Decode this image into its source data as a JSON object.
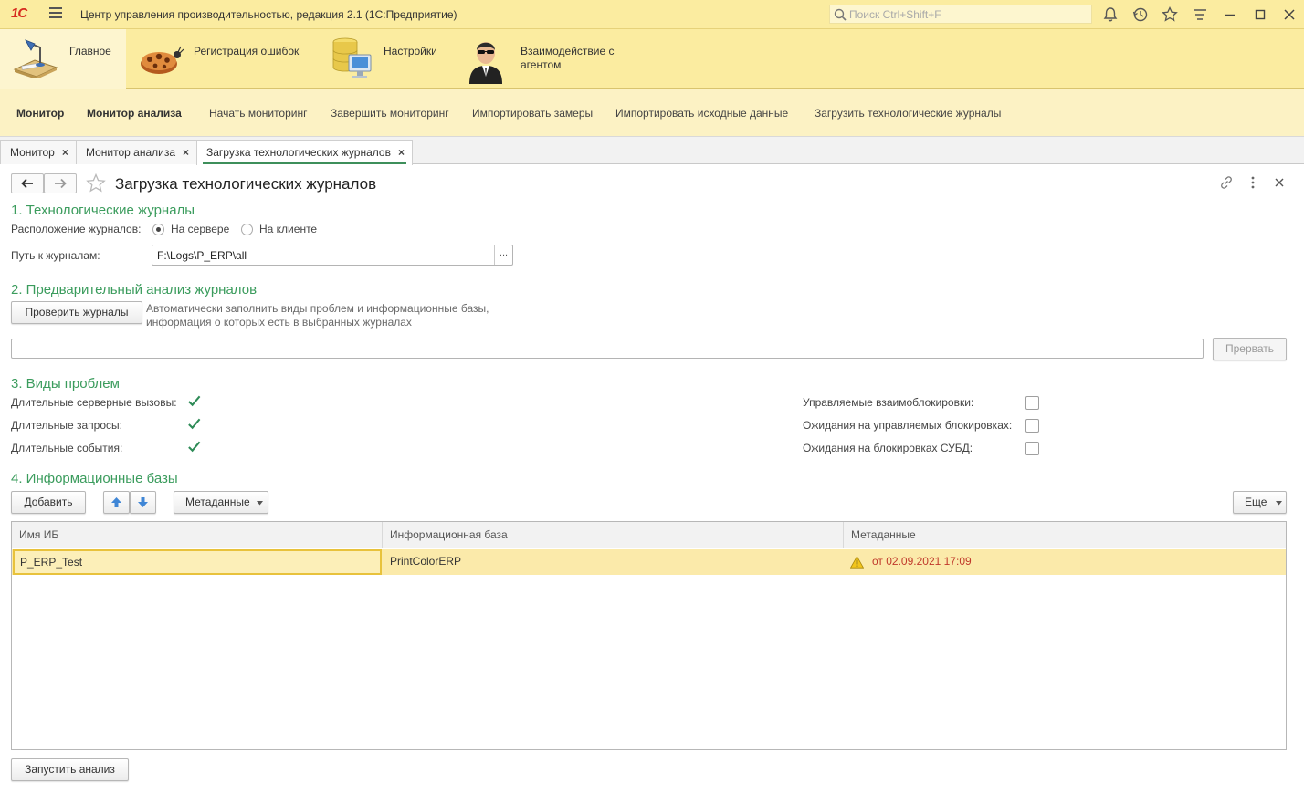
{
  "app": {
    "logo": "1С",
    "title": "Центр управления производительностью, редакция 2.1  (1С:Предприятие)",
    "search_placeholder": "Поиск Ctrl+Shift+F"
  },
  "sections": [
    {
      "label": "Главное"
    },
    {
      "label": "Регистрация ошибок"
    },
    {
      "label": "Настройки"
    },
    {
      "label": "Взаимодействие с агентом"
    }
  ],
  "actions": [
    {
      "label": "Монитор"
    },
    {
      "label": "Монитор анализа"
    },
    {
      "label": "Начать мониторинг"
    },
    {
      "label": "Завершить мониторинг"
    },
    {
      "label": "Импортировать замеры"
    },
    {
      "label": "Импортировать исходные данные"
    },
    {
      "label": "Загрузить технологические журналы"
    }
  ],
  "open_tabs": [
    {
      "label": "Монитор",
      "close": "×"
    },
    {
      "label": "Монитор анализа",
      "close": "×"
    },
    {
      "label": "Загрузка технологических журналов",
      "close": "×"
    }
  ],
  "form": {
    "title": "Загрузка технологических журналов",
    "s1": {
      "heading": "1. Технологические журналы",
      "location_label": "Расположение журналов:",
      "opt_server": "На сервере",
      "opt_client": "На клиенте",
      "selected": "server",
      "path_label": "Путь к журналам:",
      "path_value": "F:\\Logs\\P_ERP\\all",
      "browse": "..."
    },
    "s2": {
      "heading": "2. Предварительный анализ журналов",
      "check_button": "Проверить журналы",
      "hint_line1": "Автоматически заполнить виды проблем и информационные базы,",
      "hint_line2": "информация о которых есть в выбранных журналах",
      "stop_button": "Прервать"
    },
    "s3": {
      "heading": "3. Виды проблем",
      "left": [
        {
          "label": "Длительные серверные вызовы:",
          "checked": true
        },
        {
          "label": "Длительные запросы:",
          "checked": true
        },
        {
          "label": "Длительные события:",
          "checked": true
        }
      ],
      "right": [
        {
          "label": "Управляемые взаимоблокировки:",
          "checked": false
        },
        {
          "label": "Ожидания на управляемых блокировках:",
          "checked": false
        },
        {
          "label": "Ожидания на блокировках СУБД:",
          "checked": false
        }
      ]
    },
    "s4": {
      "heading": "4. Информационные базы",
      "add_button": "Добавить",
      "metadata_button": "Метаданные",
      "more_button": "Еще",
      "columns": [
        "Имя ИБ",
        "Информационная база",
        "Метаданные"
      ],
      "rows": [
        {
          "name": "P_ERP_Test",
          "base": "PrintColorERP",
          "metadata": "от 02.09.2021 17:09"
        }
      ]
    },
    "run_button": "Запустить анализ"
  },
  "colors": {
    "accent_green": "#3b9c5d",
    "panel_yellow": "#fbeca0",
    "warning": "#c0392b"
  }
}
